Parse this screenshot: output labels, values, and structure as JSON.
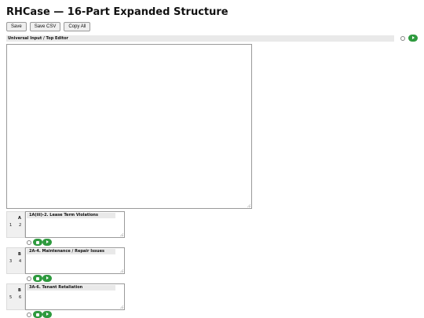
{
  "page_title": "RHCase — 16-Part Expanded Structure",
  "toolbar": {
    "save_label": "Save",
    "save_csv_label": "Save CSV",
    "copy_all_label": "Copy All"
  },
  "top_editor": {
    "label": "Universal Input / Top Editor",
    "value": ""
  },
  "sections": [
    {
      "left_num": "1",
      "right_num": "2",
      "letter": "A",
      "title": "1A(iii)-2. Lease Term Violations"
    },
    {
      "left_num": "3",
      "right_num": "4",
      "letter": "B",
      "title": "2A-4. Maintenance / Repair Issues"
    },
    {
      "left_num": "5",
      "right_num": "6",
      "letter": "B",
      "title": "3A-6. Tenant Retaliation"
    }
  ],
  "icons": {
    "run": "play-icon",
    "stop": "stop-icon",
    "select": "radio"
  },
  "colors": {
    "accent": "#2e9a3e"
  }
}
